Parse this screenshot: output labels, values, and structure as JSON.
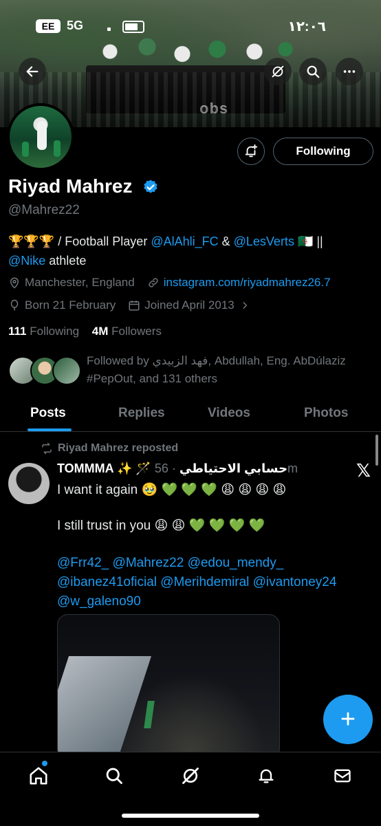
{
  "status_bar": {
    "carrier_badge": "EE",
    "network": "5G",
    "time": "١٢:٠٦"
  },
  "banner": {
    "bus_text": "obs"
  },
  "profile": {
    "name": "Riyad Mahrez",
    "handle": "@Mahrez22",
    "following_button": "Following",
    "bio_emoji": "🏆🏆🏆",
    "bio_parts": {
      "p1": " / Football Player ",
      "m1": "@AlAhli_FC",
      "p2": " & ",
      "m2": "@LesVerts",
      "flag": " 🇩🇿 ",
      "p3": "||",
      "m3": "@Nike",
      "p4": " athlete"
    },
    "location": "Manchester, England",
    "website": "instagram.com/riyadmahrez26.7",
    "born": "Born 21 February",
    "joined": "Joined April 2013",
    "following_count": "111",
    "following_label": "Following",
    "followers_count": "4M",
    "followers_label": "Followers",
    "followed_by": "Followed by فهد الزبيدي, Abdullah, Eng. AbDúlaziz #PepOut, and 131 others"
  },
  "tabs": [
    {
      "label": "Posts"
    },
    {
      "label": "Replies"
    },
    {
      "label": "Videos"
    },
    {
      "label": "Photos"
    }
  ],
  "post": {
    "repost_label": "Riyad Mahrez reposted",
    "author": "TOMMMA ✨ 🪄 حسابي الاحتياطي",
    "time": "· 56m",
    "line1": "I want it again 🥹 💚 💚 💚 😩 😩 😩 😩",
    "line2": "I still trust in you 😩 😩 💚 💚 💚 💚",
    "mentions_line1": "@Frr42_ @Mahrez22 @edou_mendy_",
    "mentions_line2": "@ibanez41oficial @Merihdemiral @ivantoney24",
    "mentions_line3": "@w_galeno90",
    "x_logo": "𝕏"
  },
  "fab_label": "+",
  "icons": {
    "back": "back-arrow-icon",
    "grok": "grok-icon",
    "search": "search-icon",
    "more": "more-icon",
    "alert": "notification-add-icon",
    "verified": "verified-badge-icon",
    "location": "location-icon",
    "link": "link-icon",
    "birthday": "balloon-icon",
    "calendar": "calendar-icon",
    "repost": "repost-icon",
    "home": "home-icon",
    "explore": "search-icon",
    "grok_nav": "grok-icon",
    "notifications": "bell-icon",
    "messages": "mail-icon"
  },
  "colors": {
    "accent": "#1d9bf0",
    "muted": "#71767b",
    "background": "#000000"
  }
}
